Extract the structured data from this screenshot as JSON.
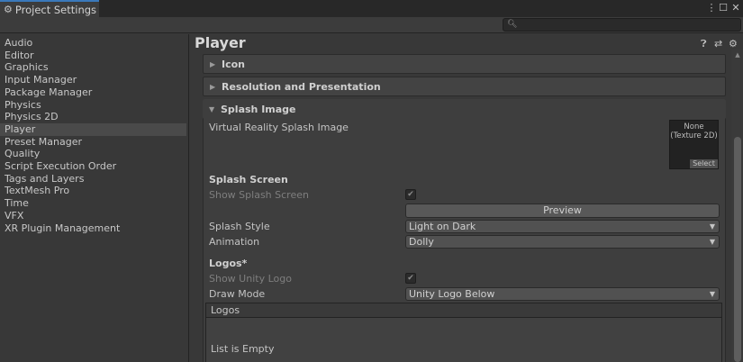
{
  "window": {
    "title": "Project Settings",
    "search_placeholder": "",
    "buttons": {
      "menu": "⋮",
      "maximize": "☐",
      "close": "✕"
    }
  },
  "sidebar": {
    "items": [
      {
        "label": "Audio"
      },
      {
        "label": "Editor"
      },
      {
        "label": "Graphics"
      },
      {
        "label": "Input Manager"
      },
      {
        "label": "Package Manager"
      },
      {
        "label": "Physics"
      },
      {
        "label": "Physics 2D"
      },
      {
        "label": "Player",
        "selected": true
      },
      {
        "label": "Preset Manager"
      },
      {
        "label": "Quality"
      },
      {
        "label": "Script Execution Order"
      },
      {
        "label": "Tags and Layers"
      },
      {
        "label": "TextMesh Pro"
      },
      {
        "label": "Time"
      },
      {
        "label": "VFX"
      },
      {
        "label": "XR Plugin Management"
      }
    ]
  },
  "content": {
    "title": "Player",
    "header_icons": [
      "help-icon",
      "preset-icon",
      "settings-gear-icon"
    ],
    "sections": {
      "icon": "Icon",
      "resolution": "Resolution and Presentation",
      "splash": "Splash Image"
    },
    "splash": {
      "vr_label": "Virtual Reality Splash Image",
      "vr_value_line1": "None",
      "vr_value_line2": "(Texture 2D)",
      "vr_select": "Select",
      "splash_screen_heading": "Splash Screen",
      "show_splash_label": "Show Splash Screen",
      "show_splash_checked": true,
      "preview_button": "Preview",
      "splash_style_label": "Splash Style",
      "splash_style_value": "Light on Dark",
      "animation_label": "Animation",
      "animation_value": "Dolly",
      "logos_heading": "Logos*",
      "show_unity_logo_label": "Show Unity Logo",
      "show_unity_logo_checked": true,
      "draw_mode_label": "Draw Mode",
      "draw_mode_value": "Unity Logo Below",
      "logos_list_header": "Logos",
      "logos_list_empty": "List is Empty"
    }
  },
  "colors": {
    "accent_tab": "#3a79bb",
    "background": "#383838",
    "selected_item": "#4a4a4a"
  }
}
